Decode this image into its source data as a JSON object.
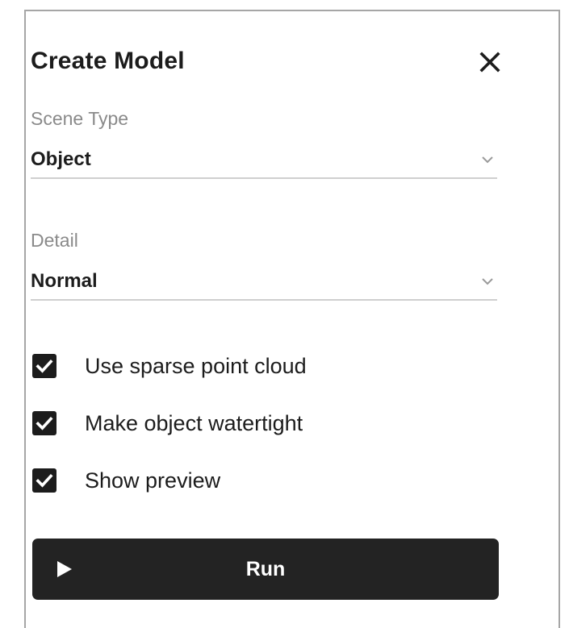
{
  "dialog": {
    "title": "Create Model",
    "close_icon": "close-icon"
  },
  "scene_type": {
    "label": "Scene Type",
    "value": "Object",
    "icon": "chevron-down-icon"
  },
  "detail": {
    "label": "Detail",
    "value": "Normal",
    "icon": "chevron-down-icon"
  },
  "options": [
    {
      "label": "Use sparse point cloud",
      "checked": true,
      "icon": "checkmark-icon"
    },
    {
      "label": "Make object watertight",
      "checked": true,
      "icon": "checkmark-icon"
    },
    {
      "label": "Show preview",
      "checked": true,
      "icon": "checkmark-icon"
    }
  ],
  "run_button": {
    "label": "Run",
    "icon": "play-icon"
  },
  "colors": {
    "button_background": "#232323",
    "checkbox_fill": "#1c1c1c",
    "label_gray": "#8a8a8a",
    "underline": "#cfcfcf",
    "panel_border": "#a6a6a6"
  }
}
